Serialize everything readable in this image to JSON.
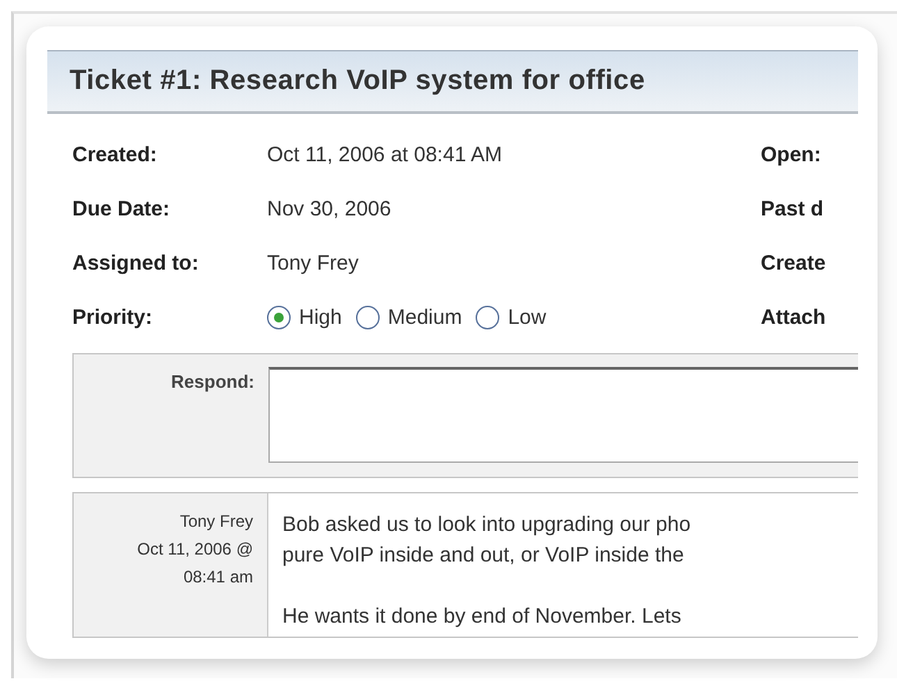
{
  "ticket": {
    "title": "Ticket #1: Research VoIP system for office",
    "fields": [
      {
        "label": "Created:",
        "value": "Oct 11, 2006 at 08:41 AM",
        "side_label": "Open:"
      },
      {
        "label": "Due Date:",
        "value": "Nov 30, 2006",
        "side_label": "Past d"
      },
      {
        "label": "Assigned to:",
        "value": "Tony Frey",
        "side_label": "Create"
      }
    ],
    "priority": {
      "label": "Priority:",
      "side_label": "Attach",
      "options": [
        {
          "label": "High",
          "selected": true
        },
        {
          "label": "Medium",
          "selected": false
        },
        {
          "label": "Low",
          "selected": false
        }
      ]
    },
    "respond": {
      "label": "Respond:"
    },
    "comments": [
      {
        "author": "Tony Frey",
        "date": "Oct 11, 2006 @",
        "time": "08:41 am",
        "paragraphs": [
          [
            "Bob asked us to look into upgrading our pho",
            "pure VoIP inside and out, or VoIP inside the"
          ],
          [
            "He wants it done by end of November. Lets"
          ]
        ]
      }
    ]
  }
}
